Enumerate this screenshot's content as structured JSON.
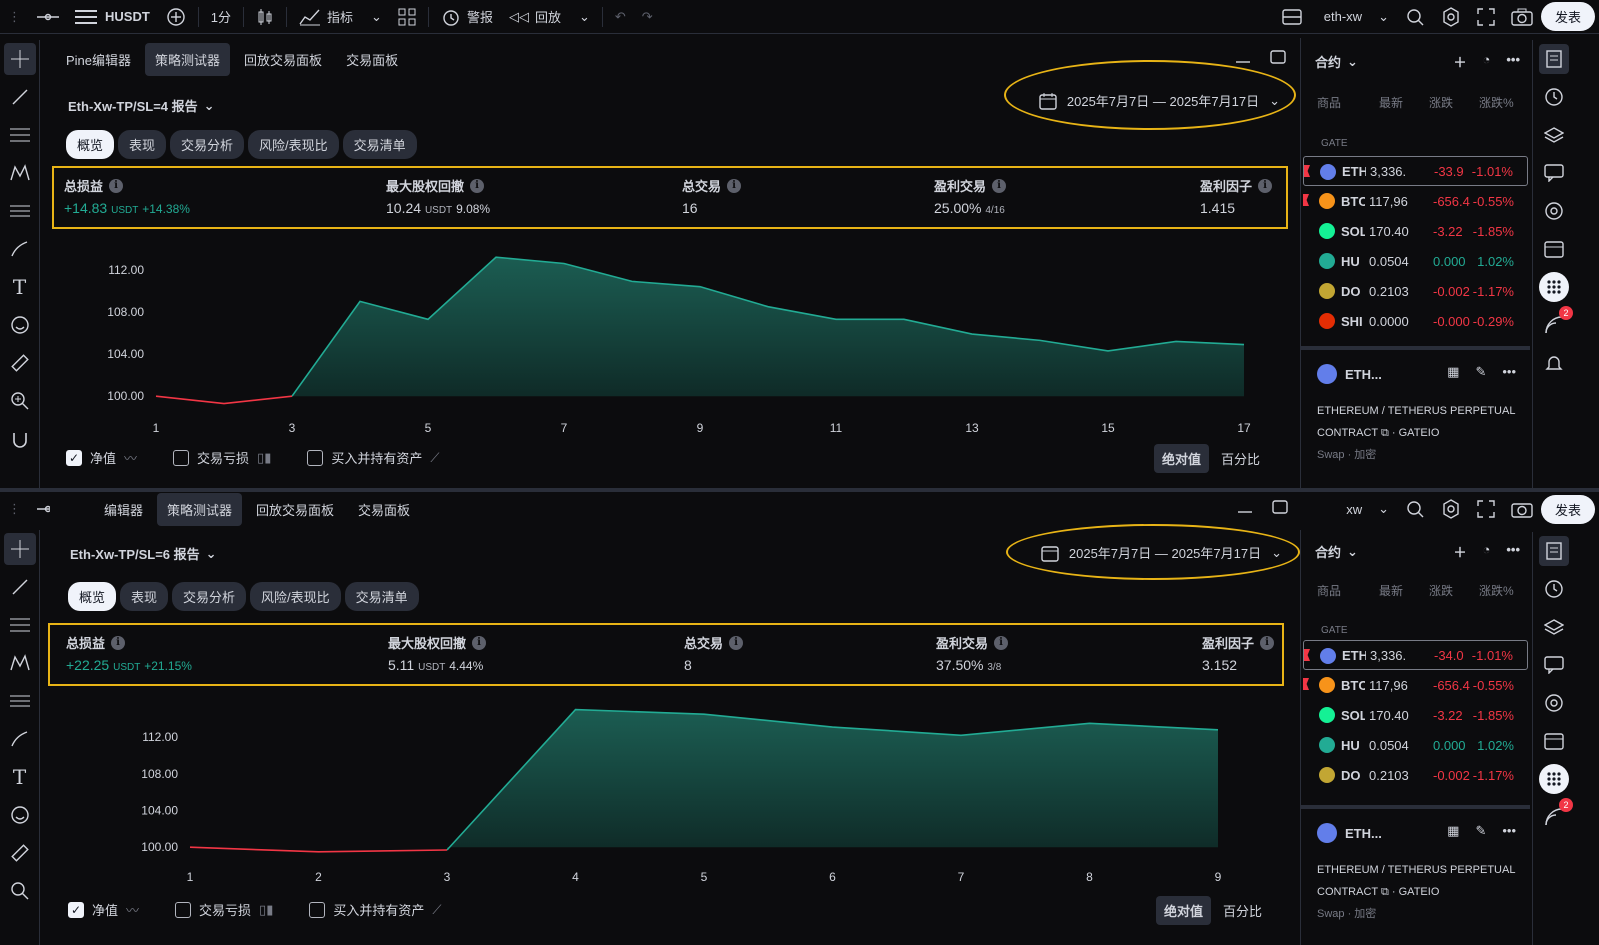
{
  "toolbar": {
    "symbol": "HUSDT",
    "interval": "1分",
    "indicators": "指标",
    "alert": "警报",
    "replay": "回放",
    "layout_name": "eth-xw",
    "publish": "发表"
  },
  "bottom_toolbar": {
    "layout_name": "xw",
    "publish": "发表"
  },
  "tester_tabs": [
    "Pine编辑器",
    "策略测试器",
    "回放交易面板",
    "交易面板"
  ],
  "tester_tabs_bottom": [
    "编辑器",
    "策略测试器",
    "回放交易面板",
    "交易面板"
  ],
  "subtabs": [
    "概览",
    "表现",
    "交易分析",
    "风险/表现比",
    "交易清单"
  ],
  "metric_labels": {
    "net_profit": "总损益",
    "drawdown": "最大股权回撤",
    "total_trades": "总交易",
    "win_trades": "盈利交易",
    "profit_factor": "盈利因子"
  },
  "unit": "USDT",
  "legend": {
    "equity": "净值",
    "trade_pnl": "交易亏损",
    "buy_hold": "买入并持有资产",
    "absolute": "绝对值",
    "percent": "百分比"
  },
  "reports": [
    {
      "title": "Eth-Xw-TP/SL=4 报告",
      "date_range": "2025年7月7日 — 2025年7月17日",
      "net_profit": "+14.83",
      "net_profit_pct": "+14.38%",
      "drawdown": "10.24",
      "drawdown_pct": "9.08%",
      "total_trades": "16",
      "win_rate": "25.00%",
      "win_ratio": "4/16",
      "profit_factor": "1.415",
      "chart_data": {
        "type": "area",
        "x_ticks": [
          "1",
          "3",
          "5",
          "7",
          "9",
          "11",
          "13",
          "15",
          "17"
        ],
        "y_ticks": [
          "112.00",
          "108.00",
          "104.00",
          "100.00"
        ],
        "ylim": [
          98.5,
          113.5
        ],
        "x": [
          1,
          2,
          3,
          4,
          5,
          6,
          7,
          8,
          9,
          10,
          11,
          12,
          13,
          14,
          15,
          16,
          17
        ],
        "values": [
          100.0,
          99.3,
          100.0,
          109.0,
          107.3,
          113.2,
          112.6,
          110.9,
          110.4,
          108.5,
          107.3,
          107.3,
          105.9,
          105.3,
          104.3,
          105.2,
          104.9
        ],
        "negative_until": 3
      }
    },
    {
      "title": "Eth-Xw-TP/SL=6 报告",
      "date_range": "2025年7月7日 — 2025年7月17日",
      "net_profit": "+22.25",
      "net_profit_pct": "+21.15%",
      "drawdown": "5.11",
      "drawdown_pct": "4.44%",
      "total_trades": "8",
      "win_rate": "37.50%",
      "win_ratio": "3/8",
      "profit_factor": "3.152",
      "chart_data": {
        "type": "area",
        "x_ticks": [
          "1",
          "2",
          "3",
          "4",
          "5",
          "6",
          "7",
          "8",
          "9"
        ],
        "y_ticks": [
          "112.00",
          "108.00",
          "104.00",
          "100.00"
        ],
        "ylim": [
          98.5,
          115.5
        ],
        "x": [
          1,
          2,
          3,
          4,
          5,
          6,
          7,
          8,
          9
        ],
        "values": [
          100.0,
          99.5,
          99.7,
          115.0,
          114.5,
          113.1,
          112.2,
          113.5,
          112.8
        ],
        "negative_until": 3
      }
    }
  ],
  "watchlist": {
    "header": "合约",
    "cols": [
      "商品",
      "最新",
      "涨跌",
      "涨跌%"
    ],
    "group": "GATE",
    "rows": [
      {
        "sym": "ETH",
        "last": "3,336.",
        "chg": "-33.9",
        "pct": "-1.01%",
        "up": false,
        "coin": "#627eea",
        "flag": true,
        "sel": true
      },
      {
        "sym": "BTC",
        "last": "117,96",
        "chg": "-656.4",
        "pct": "-0.55%",
        "up": false,
        "coin": "#f7931a",
        "flag": true,
        "sel": false
      },
      {
        "sym": "SOL",
        "last": "170.40",
        "chg": "-3.22",
        "pct": "-1.85%",
        "up": false,
        "coin": "#14f195",
        "flag": false,
        "sel": false
      },
      {
        "sym": "HU",
        "last": "0.0504",
        "chg": "0.000",
        "pct": "1.02%",
        "up": true,
        "coin": "#22ab94",
        "flag": false,
        "sel": false
      },
      {
        "sym": "DO",
        "last": "0.2103",
        "chg": "-0.002",
        "pct": "-1.17%",
        "up": false,
        "coin": "#c2a633",
        "flag": false,
        "sel": false
      },
      {
        "sym": "SHI",
        "last": "0.0000",
        "chg": "-0.000",
        "pct": "-0.29%",
        "up": false,
        "coin": "#e42d04",
        "flag": false,
        "sel": false
      }
    ],
    "rows_bottom": [
      {
        "sym": "ETH",
        "last": "3,336.",
        "chg": "-34.0",
        "pct": "-1.01%",
        "up": false,
        "coin": "#627eea",
        "flag": true,
        "sel": true
      },
      {
        "sym": "BTC",
        "last": "117,96",
        "chg": "-656.4",
        "pct": "-0.55%",
        "up": false,
        "coin": "#f7931a",
        "flag": true,
        "sel": false
      },
      {
        "sym": "SOL",
        "last": "170.40",
        "chg": "-3.22",
        "pct": "-1.85%",
        "up": false,
        "coin": "#14f195",
        "flag": false,
        "sel": false
      },
      {
        "sym": "HU",
        "last": "0.0504",
        "chg": "0.000",
        "pct": "1.02%",
        "up": true,
        "coin": "#22ab94",
        "flag": false,
        "sel": false
      },
      {
        "sym": "DO",
        "last": "0.2103",
        "chg": "-0.002",
        "pct": "-1.17%",
        "up": false,
        "coin": "#c2a633",
        "flag": false,
        "sel": false
      }
    ],
    "detail_symbol": "ETH...",
    "detail_desc_1": "ETHEREUM / TETHERUS PERPETUAL",
    "detail_desc_2": "CONTRACT",
    "detail_exchange": "· GATEIO",
    "detail_type": "Swap · 加密"
  },
  "notifications_badge": "2",
  "colors": {
    "accent_highlight": "#e8b416",
    "profit": "#22ab94",
    "loss": "#f23645",
    "bg": "#0c0c0e"
  }
}
